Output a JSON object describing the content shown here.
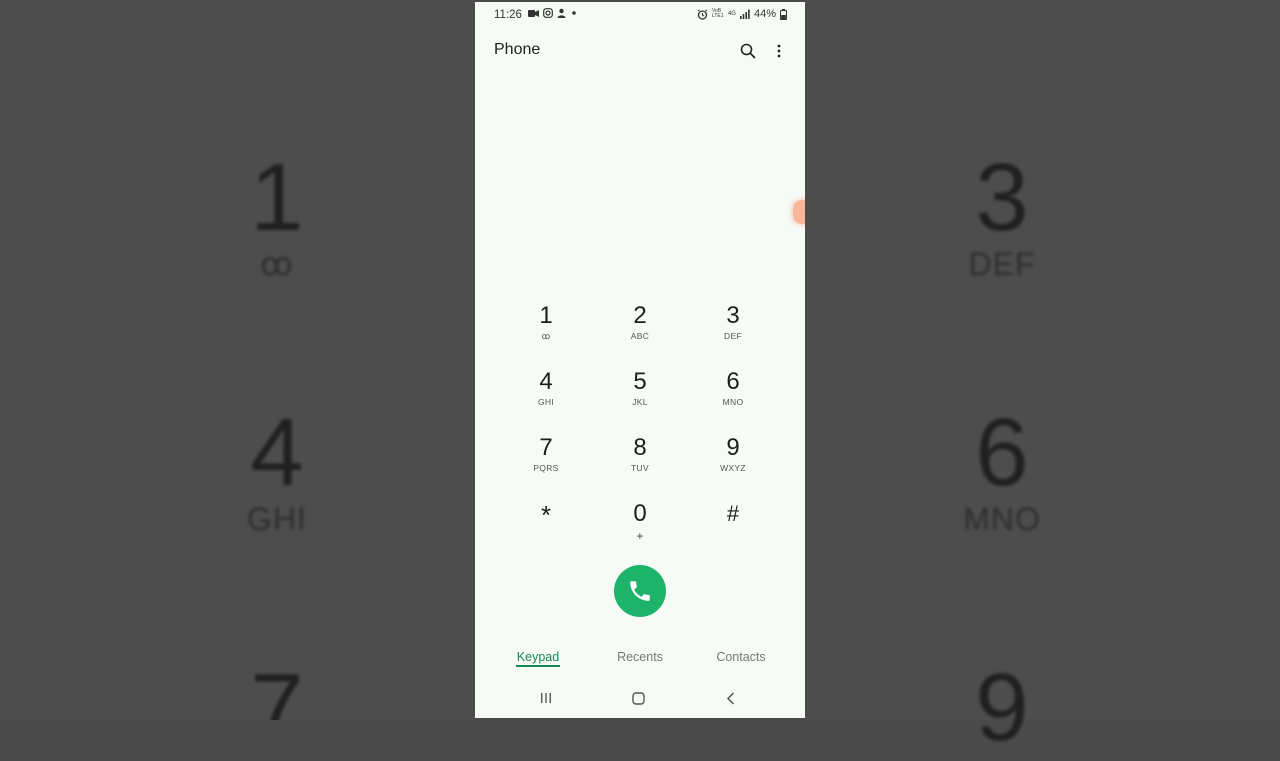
{
  "status_bar": {
    "time": "11:26",
    "battery": "44%",
    "net_volte": "VoB LTE1",
    "net_type": "4G"
  },
  "app": {
    "title": "Phone"
  },
  "keypad": [
    {
      "digit": "1",
      "sub": "ꝏ"
    },
    {
      "digit": "2",
      "sub": "ABC"
    },
    {
      "digit": "3",
      "sub": "DEF"
    },
    {
      "digit": "4",
      "sub": "GHI"
    },
    {
      "digit": "5",
      "sub": "JKL"
    },
    {
      "digit": "6",
      "sub": "MNO"
    },
    {
      "digit": "7",
      "sub": "PQRS"
    },
    {
      "digit": "8",
      "sub": "TUV"
    },
    {
      "digit": "9",
      "sub": "WXYZ"
    },
    {
      "digit": "*",
      "sub": ""
    },
    {
      "digit": "0",
      "sub": "+"
    },
    {
      "digit": "#",
      "sub": ""
    }
  ],
  "tabs": [
    {
      "label": "Keypad",
      "active": true
    },
    {
      "label": "Recents",
      "active": false
    },
    {
      "label": "Contacts",
      "active": false
    }
  ],
  "background_keys": [
    {
      "digit": "1",
      "sub": "ꝏ"
    },
    {
      "digit": "3",
      "sub": "DEF"
    },
    {
      "digit": "4",
      "sub": "GHI"
    },
    {
      "digit": "6",
      "sub": "MNO"
    },
    {
      "digit": "7",
      "sub": ""
    },
    {
      "digit": "9",
      "sub": ""
    }
  ],
  "colors": {
    "accent": "#178a57",
    "call_button": "#1db36a",
    "screen_bg": "#f6fbf6",
    "outer_bg": "#4d4d4d"
  }
}
